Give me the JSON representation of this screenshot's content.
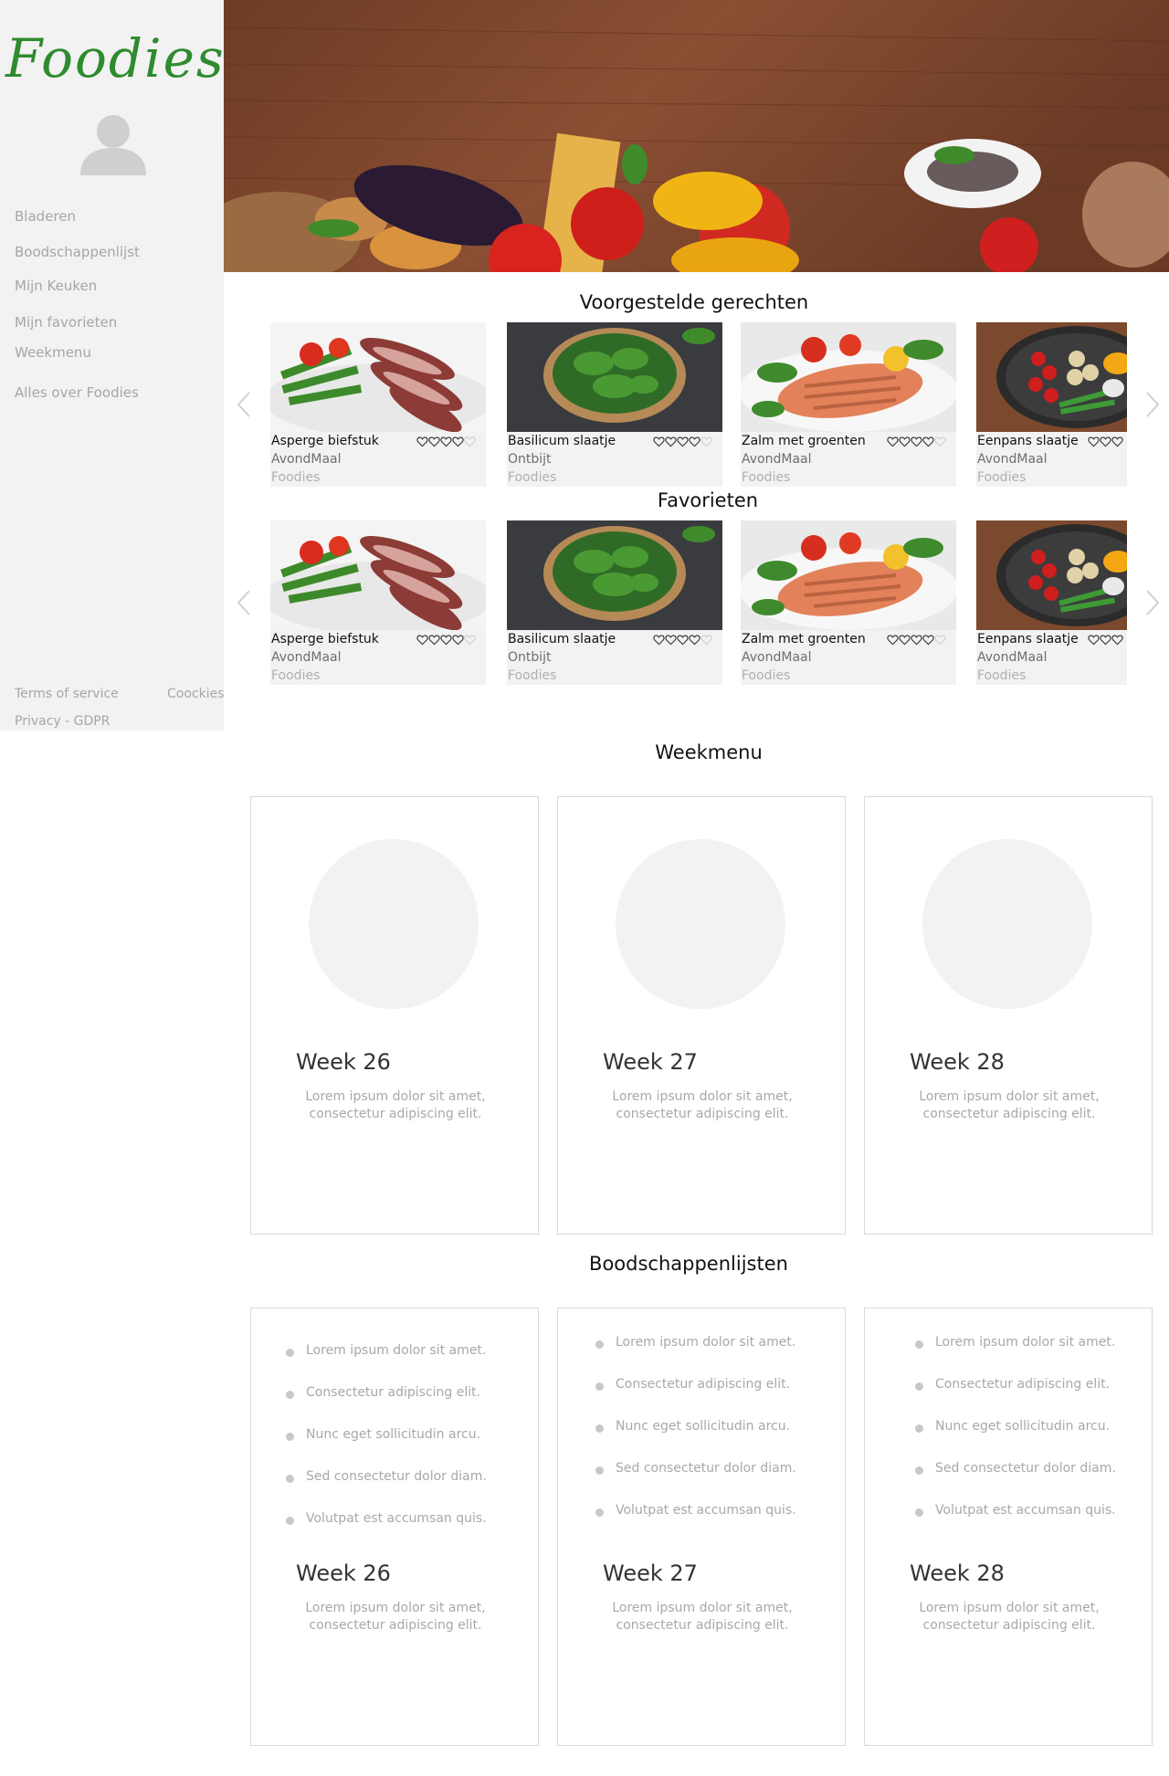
{
  "sidebar": {
    "logo": "Foodies",
    "nav": [
      "Bladeren",
      "Boodschappenlijst",
      "Mijn Keuken",
      "Mijn favorieten",
      "Weekmenu",
      "Alles over Foodies"
    ],
    "footer": {
      "terms": "Terms of service",
      "cookies": "Coockies",
      "privacy": "Privacy - GDPR"
    }
  },
  "sections": {
    "suggested": "Voorgestelde gerechten",
    "favorites": "Favorieten",
    "weekmenu": "Weekmenu",
    "shopping": "Boodschappenlijsten"
  },
  "dishes": [
    {
      "name": "Asperge biefstuk",
      "category": "AvondMaal",
      "source": "Foodies",
      "rating": 4
    },
    {
      "name": "Basilicum slaatje",
      "category": "Ontbijt",
      "source": "Foodies",
      "rating": 4
    },
    {
      "name": "Zalm met groenten",
      "category": "AvondMaal",
      "source": "Foodies",
      "rating": 4
    },
    {
      "name": "Eenpans slaatje",
      "category": "AvondMaal",
      "source": "Foodies",
      "rating": 3
    }
  ],
  "weekmenu": [
    {
      "title": "Week 26",
      "desc1": "Lorem ipsum dolor sit amet,",
      "desc2": "consectetur adipiscing elit."
    },
    {
      "title": "Week 27",
      "desc1": "Lorem ipsum dolor sit amet,",
      "desc2": "consectetur adipiscing elit."
    },
    {
      "title": "Week 28",
      "desc1": "Lorem ipsum dolor sit amet,",
      "desc2": "consectetur adipiscing elit."
    }
  ],
  "shopping": {
    "items": [
      "Lorem ipsum dolor sit amet.",
      "Consectetur adipiscing elit.",
      "Nunc eget sollicitudin arcu.",
      "Sed consectetur dolor diam.",
      "Volutpat est accumsan quis."
    ],
    "lists": [
      {
        "title": "Week 26",
        "desc1": "Lorem ipsum dolor sit amet,",
        "desc2": "consectetur adipiscing elit."
      },
      {
        "title": "Week 27",
        "desc1": "Lorem ipsum dolor sit amet,",
        "desc2": "consectetur adipiscing elit."
      },
      {
        "title": "Week 28",
        "desc1": "Lorem ipsum dolor sit amet,",
        "desc2": "consectetur adipiscing elit."
      }
    ]
  },
  "colors": {
    "sidebar": "#f2f2f2",
    "logo": "#2e8b2e",
    "muted": "#a6a6a6"
  },
  "icons": {
    "avatar": "user-silhouette-icon",
    "arrow_left": "chevron-left-icon",
    "arrow_right": "chevron-right-icon",
    "heart": "heart-outline-icon"
  }
}
